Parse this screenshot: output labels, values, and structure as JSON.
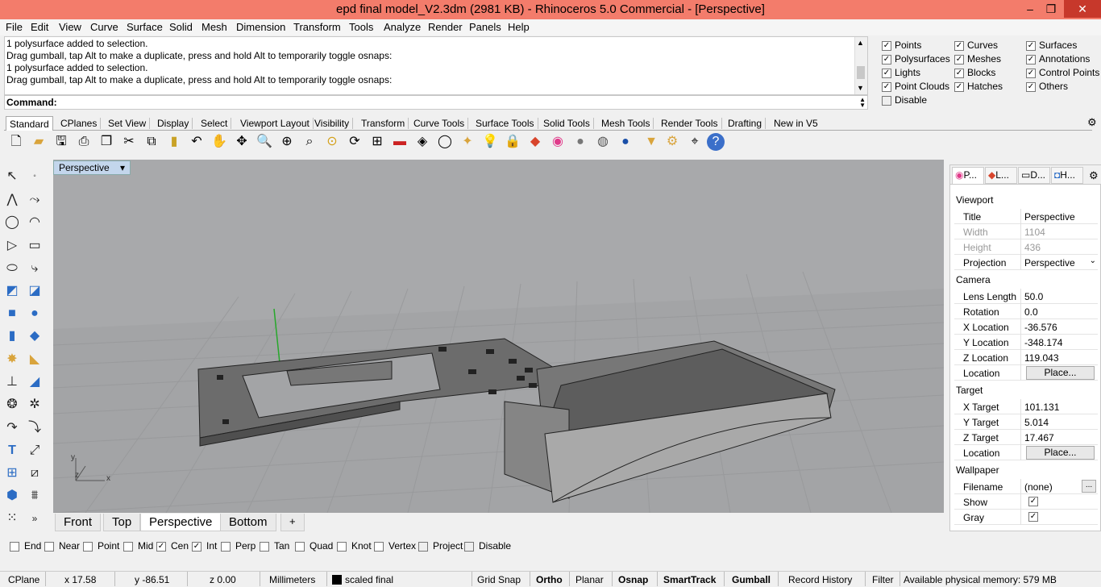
{
  "window": {
    "title": "epd final model_V2.3dm (2981 KB) - Rhinoceros 5.0 Commercial - [Perspective]",
    "min": "–",
    "max": "❐",
    "close": "✕"
  },
  "menu": [
    "File",
    "Edit",
    "View",
    "Curve",
    "Surface",
    "Solid",
    "Mesh",
    "Dimension",
    "Transform",
    "Tools",
    "Analyze",
    "Render",
    "Panels",
    "Help"
  ],
  "history": [
    "1 polysurface added to selection.",
    "Drag gumball, tap Alt to make a duplicate, press and hold Alt to temporarily toggle osnaps:",
    "1 polysurface added to selection.",
    "Drag gumball, tap Alt to make a duplicate, press and hold Alt to temporarily toggle osnaps:"
  ],
  "command": {
    "label": "Command:",
    "value": ""
  },
  "filters": [
    {
      "label": "Points",
      "checked": true
    },
    {
      "label": "Curves",
      "checked": true
    },
    {
      "label": "Surfaces",
      "checked": true
    },
    {
      "label": "Polysurfaces",
      "checked": true
    },
    {
      "label": "Meshes",
      "checked": true
    },
    {
      "label": "Annotations",
      "checked": true
    },
    {
      "label": "Lights",
      "checked": true
    },
    {
      "label": "Blocks",
      "checked": true
    },
    {
      "label": "Control Points",
      "checked": true
    },
    {
      "label": "Point Clouds",
      "checked": true
    },
    {
      "label": "Hatches",
      "checked": true
    },
    {
      "label": "Others",
      "checked": true
    },
    {
      "label": "Disable",
      "checked": false
    }
  ],
  "toolbar_tabs": [
    "Standard",
    "CPlanes",
    "Set View",
    "Display",
    "Select",
    "Viewport Layout",
    "Visibility",
    "Transform",
    "Curve Tools",
    "Surface Tools",
    "Solid Tools",
    "Mesh Tools",
    "Render Tools",
    "Drafting",
    "New in V5"
  ],
  "active_toolbar_tab": "Standard",
  "toolbar_icons": [
    "new-icon",
    "open-icon",
    "save-icon",
    "print-icon",
    "import-icon",
    "cut-icon",
    "copy-icon",
    "paste-icon",
    "undo-icon",
    "pan-icon",
    "move-view-icon",
    "zoom-icon",
    "zoom-window-icon",
    "zoom-extents-icon",
    "zoom-selected-icon",
    "rotate-view-icon",
    "four-viewports-icon",
    "car-icon",
    "render-preview-icon",
    "circle-icon",
    "point-icon",
    "lightbulb-icon",
    "lock-icon",
    "layer-icon",
    "color-wheel-icon",
    "sphere-gray-icon",
    "sphere-shaded-icon",
    "sphere-blue-icon",
    "osnap-icon",
    "settings-icon",
    "gumball-icon",
    "help-icon"
  ],
  "left_tools": [
    "select-arrow-icon",
    "point-icon",
    "polyline-icon",
    "curve-icon",
    "circle-icon",
    "arc-icon",
    "rectangle-icon",
    "polygon-icon",
    "ellipse-icon",
    "fillet-icon",
    "surface-icon",
    "surface-edge-icon",
    "box-icon",
    "sphere-icon",
    "cylinder-icon",
    "mesh-icon",
    "explode-icon",
    "trim-icon",
    "move-icon",
    "copy-icon",
    "boolean-icon",
    "cap-icon",
    "curve-from-object-icon",
    "offset-icon",
    "text-icon",
    "dimension-icon",
    "array-icon",
    "mirror-icon",
    "block-icon",
    "hatch-icon",
    "grid-icon",
    "more-icon"
  ],
  "viewport": {
    "label": "Perspective",
    "menu_arrow": "▾",
    "axis_x": "x",
    "axis_y": "y",
    "axis_z": "z"
  },
  "viewport_tabs": [
    "Front",
    "Top",
    "Perspective",
    "Bottom"
  ],
  "active_viewport_tab": "Perspective",
  "add_tab": "+",
  "panel": {
    "tabs": [
      "P...",
      "L...",
      "D...",
      "H..."
    ],
    "viewport_section": "Viewport",
    "viewport_props": [
      {
        "k": "Title",
        "v": "Perspective",
        "gray": false
      },
      {
        "k": "Width",
        "v": "1104",
        "gray": true
      },
      {
        "k": "Height",
        "v": "436",
        "gray": true
      },
      {
        "k": "Projection",
        "v": "Perspective",
        "gray": false,
        "dropdown": true
      }
    ],
    "camera_section": "Camera",
    "camera_props": [
      {
        "k": "Lens Length",
        "v": "50.0"
      },
      {
        "k": "Rotation",
        "v": "0.0"
      },
      {
        "k": "X Location",
        "v": "-36.576"
      },
      {
        "k": "Y Location",
        "v": "-348.174"
      },
      {
        "k": "Z Location",
        "v": "119.043"
      },
      {
        "k": "Location",
        "btn": "Place..."
      }
    ],
    "target_section": "Target",
    "target_props": [
      {
        "k": "X Target",
        "v": "101.131"
      },
      {
        "k": "Y Target",
        "v": "5.014"
      },
      {
        "k": "Z Target",
        "v": "17.467"
      },
      {
        "k": "Location",
        "btn": "Place..."
      }
    ],
    "wallpaper_section": "Wallpaper",
    "wallpaper_props": [
      {
        "k": "Filename",
        "v": "(none)",
        "btn": "..."
      },
      {
        "k": "Show",
        "checked": true
      },
      {
        "k": "Gray",
        "checked": true
      }
    ]
  },
  "osnaps": [
    {
      "label": "End",
      "checked": false
    },
    {
      "label": "Near",
      "checked": false
    },
    {
      "label": "Point",
      "checked": false
    },
    {
      "label": "Mid",
      "checked": false
    },
    {
      "label": "Cen",
      "checked": true
    },
    {
      "label": "Int",
      "checked": true
    },
    {
      "label": "Perp",
      "checked": false
    },
    {
      "label": "Tan",
      "checked": false
    },
    {
      "label": "Quad",
      "checked": false
    },
    {
      "label": "Knot",
      "checked": false
    },
    {
      "label": "Vertex",
      "checked": false
    },
    {
      "label": "Project",
      "checked": false
    },
    {
      "label": "Disable",
      "checked": false
    }
  ],
  "status": {
    "cplane": "CPlane",
    "x": "x 17.58",
    "y": "y -86.51",
    "z": "z 0.00",
    "units": "Millimeters",
    "layer": "scaled final",
    "grid_snap": "Grid Snap",
    "ortho": "Ortho",
    "planar": "Planar",
    "osnap": "Osnap",
    "smarttrack": "SmartTrack",
    "gumball": "Gumball",
    "record_history": "Record History",
    "filter": "Filter",
    "memory": "Available physical memory: 579 MB"
  }
}
